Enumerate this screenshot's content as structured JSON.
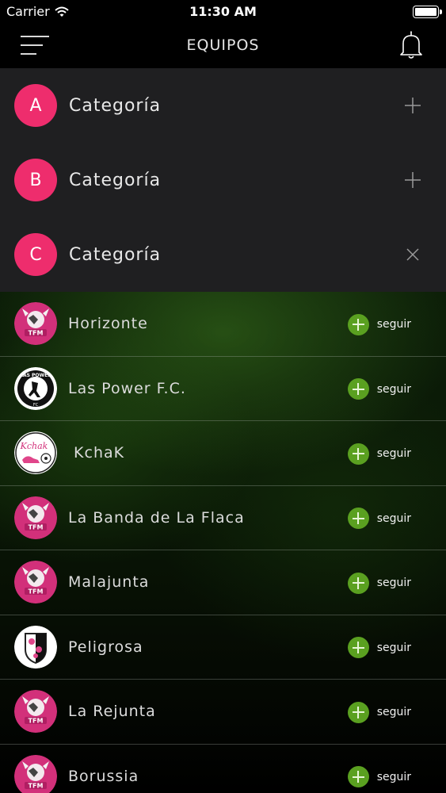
{
  "status_bar": {
    "carrier": "Carrier",
    "time": "11:30 AM"
  },
  "nav": {
    "title": "EQUIPOS"
  },
  "categories": [
    {
      "letter": "A",
      "label": "Categoría",
      "action": "plus-icon"
    },
    {
      "letter": "B",
      "label": "Categoría",
      "action": "plus-icon"
    },
    {
      "letter": "C",
      "label": "Categoría",
      "action": "close-icon"
    }
  ],
  "teams": [
    {
      "name": "Horizonte",
      "logo": "tfm-logo",
      "follow": "seguir"
    },
    {
      "name": "Las Power F.C.",
      "logo": "las-power-logo",
      "follow": "seguir"
    },
    {
      "name": " KchaK",
      "logo": "kchak-logo",
      "follow": "seguir"
    },
    {
      "name": "La Banda de La Flaca",
      "logo": "tfm-logo",
      "follow": "seguir"
    },
    {
      "name": "Malajunta",
      "logo": "tfm-logo",
      "follow": "seguir"
    },
    {
      "name": "Peligrosa",
      "logo": "peligrosa-logo",
      "follow": "seguir"
    },
    {
      "name": "La Rejunta",
      "logo": "tfm-logo",
      "follow": "seguir"
    },
    {
      "name": "Borussia",
      "logo": "tfm-logo",
      "follow": "seguir"
    }
  ],
  "colors": {
    "accent": "#ee2d6d",
    "follow_green": "#5aa020",
    "category_bg": "#1f1f21"
  }
}
